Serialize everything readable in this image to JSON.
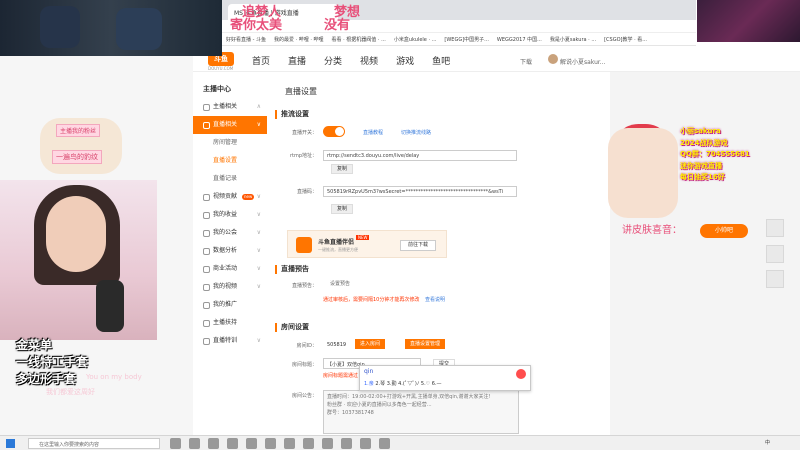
{
  "browser": {
    "tab_title": "MS 斗鱼直播 | 游戏直播",
    "bookmarks": [
      "好好看直播 - 斗鱼",
      "我的最爱 · 哔哩 · 哔哩",
      "看看 · 根据机器阀值 · ...",
      "小米盒ukulele · ...",
      "[WEGG]中国男子...",
      "WEGG2017 中国...",
      "我是小夏sakura · ...",
      "[CSGO]教学 · 看..."
    ]
  },
  "site": {
    "logo": "斗鱼",
    "logo_sub": "DOUYU.COM",
    "nav": [
      "首页",
      "直播",
      "分类",
      "视频",
      "游戏",
      "鱼吧"
    ],
    "download": "下载",
    "user": "解说小夏sakur..."
  },
  "sidebar": {
    "title": "主播中心",
    "items": [
      {
        "label": "主播相关",
        "arrow": "∧"
      },
      {
        "label": "直播相关",
        "arrow": "∨",
        "active": true
      },
      {
        "label": "房间管理",
        "sub": true
      },
      {
        "label": "直播设置",
        "sub": true,
        "current": true
      },
      {
        "label": "直播记录",
        "sub": true
      },
      {
        "label": "视频贡献",
        "arrow": "∨",
        "badge": "new"
      },
      {
        "label": "我的收益",
        "arrow": "∨"
      },
      {
        "label": "我的公会",
        "arrow": "∨"
      },
      {
        "label": "数据分析",
        "arrow": "∨"
      },
      {
        "label": "商业活动",
        "arrow": "∨"
      },
      {
        "label": "我的视频",
        "arrow": "∨"
      },
      {
        "label": "我的推广",
        "arrow": ""
      },
      {
        "label": "主播扶持",
        "arrow": ""
      },
      {
        "label": "直播特训",
        "arrow": "∨"
      }
    ]
  },
  "main": {
    "page_title": "直播设置",
    "push": {
      "heading": "推流设置",
      "switch_label": "直播开关：",
      "tutorial_link": "直播教程",
      "rtmp_tutorial": "切换推流线路",
      "rtmp_label": "rtmp地址：",
      "rtmp_value": "rtmp://sendtc3.douyu.com/live/delay",
      "copy1": "复制",
      "code_label": "直播码：",
      "code_value": "505819rRZpvU5m3?wsSecret=*********************************&wsTi",
      "copy2": "复制",
      "promo_title": "斗鱼直播伴侣",
      "promo_new": "NEW",
      "promo_sub": "一键推流，直播更方便",
      "promo_btn": "前往下载"
    },
    "preview": {
      "heading": "直播预告",
      "label": "直播预告：",
      "btn": "设置预告",
      "warning": "通过审核后，需要间隔10分钟才能再次修改",
      "view_rules": "查看说明"
    },
    "room": {
      "heading": "房间设置",
      "id_label": "房间ID：",
      "id_value": "505819",
      "btn_enter": "进入房间",
      "btn_manage": "直播设置管理",
      "title_label": "房间标题：",
      "title_value": "【小夏】双倍qin",
      "submit": "提交",
      "title_warning": "房间标题需通过",
      "notice_label": "房间公告：",
      "notice_value": "直播时间：19:00-02:00+打游戏+开黑,主播单身,双倍qin,谢谢大家关注!\n粉丝群 · 欢迎小夏的直播间以多角色一起经营...\n群号：1037381748"
    }
  },
  "ime": {
    "input": "qin",
    "candidates": [
      "1.亲",
      "2.琴",
      "3.勤",
      "4.(ﾟ▽ﾟ)ﾉ",
      "5.♡",
      "6.—"
    ]
  },
  "overlays": {
    "top_text1": "追梦人",
    "top_text2": "寄你太美",
    "top_text3": "梦想",
    "top_text4": "没有",
    "left_badge_title": "主播我的粉丝",
    "left_badge": "一遍鸟的豹纹",
    "caption1": "金菜单",
    "caption2": "一线特工手套",
    "caption3": "多边形手套",
    "caption_small1": "You on my body",
    "caption_small2": "我们都爱这周好",
    "stream_info": [
      "小丽sakura",
      "2024战队游戏",
      "QQ群：704555681",
      "迷你游戏直播",
      "每日抽奖16好"
    ],
    "skin_line": "讲皮肤喜音：",
    "float_btn": "小帅吧"
  },
  "taskbar": {
    "search_placeholder": "在这里输入你要搜索的内容",
    "tray": "中"
  }
}
